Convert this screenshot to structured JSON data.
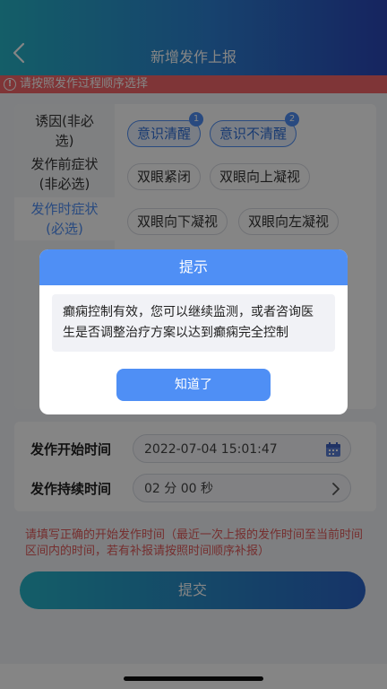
{
  "header": {
    "title": "新增发作上报"
  },
  "warning": {
    "text": "请按照发作过程顺序选择"
  },
  "categories": [
    {
      "line1": "诱因(非必",
      "line2": "选)"
    },
    {
      "line1": "发作前症状",
      "line2": "(非必选)"
    },
    {
      "line1": "发作时症状",
      "line2": "(必选)"
    }
  ],
  "chips": [
    {
      "label": "意识清醒",
      "badge": "1"
    },
    {
      "label": "意识不清醒",
      "badge": "2"
    },
    {
      "label": "双眼紧闭"
    },
    {
      "label": "双眼向上凝视"
    },
    {
      "label": "双眼向下凝视"
    },
    {
      "label": "双眼向左凝视"
    }
  ],
  "time": {
    "start_label": "发作开始时间",
    "start_value": "2022-07-04 15:01:47",
    "duration_label": "发作持续时间",
    "duration_value": "02 分 00 秒"
  },
  "hint": "请填写正确的开始发作时间（最近一次上报的发作时间至当前时间区间内的时间，若有补报请按照时间顺序补报）",
  "submit_label": "提交",
  "dialog": {
    "title": "提示",
    "message": "癫痫控制有效，您可以继续监测，或者咨询医生是否调整治疗方案以达到癫痫完全控制",
    "button": "知道了"
  },
  "colors": {
    "accent": "#4f8ff5",
    "warning": "#f4676a",
    "hint": "#e05a5a"
  },
  "icons": {
    "back": "chevron-left-icon",
    "warning": "exclamation-circle-icon",
    "calendar": "calendar-icon",
    "duration": "chevron-right-icon"
  }
}
